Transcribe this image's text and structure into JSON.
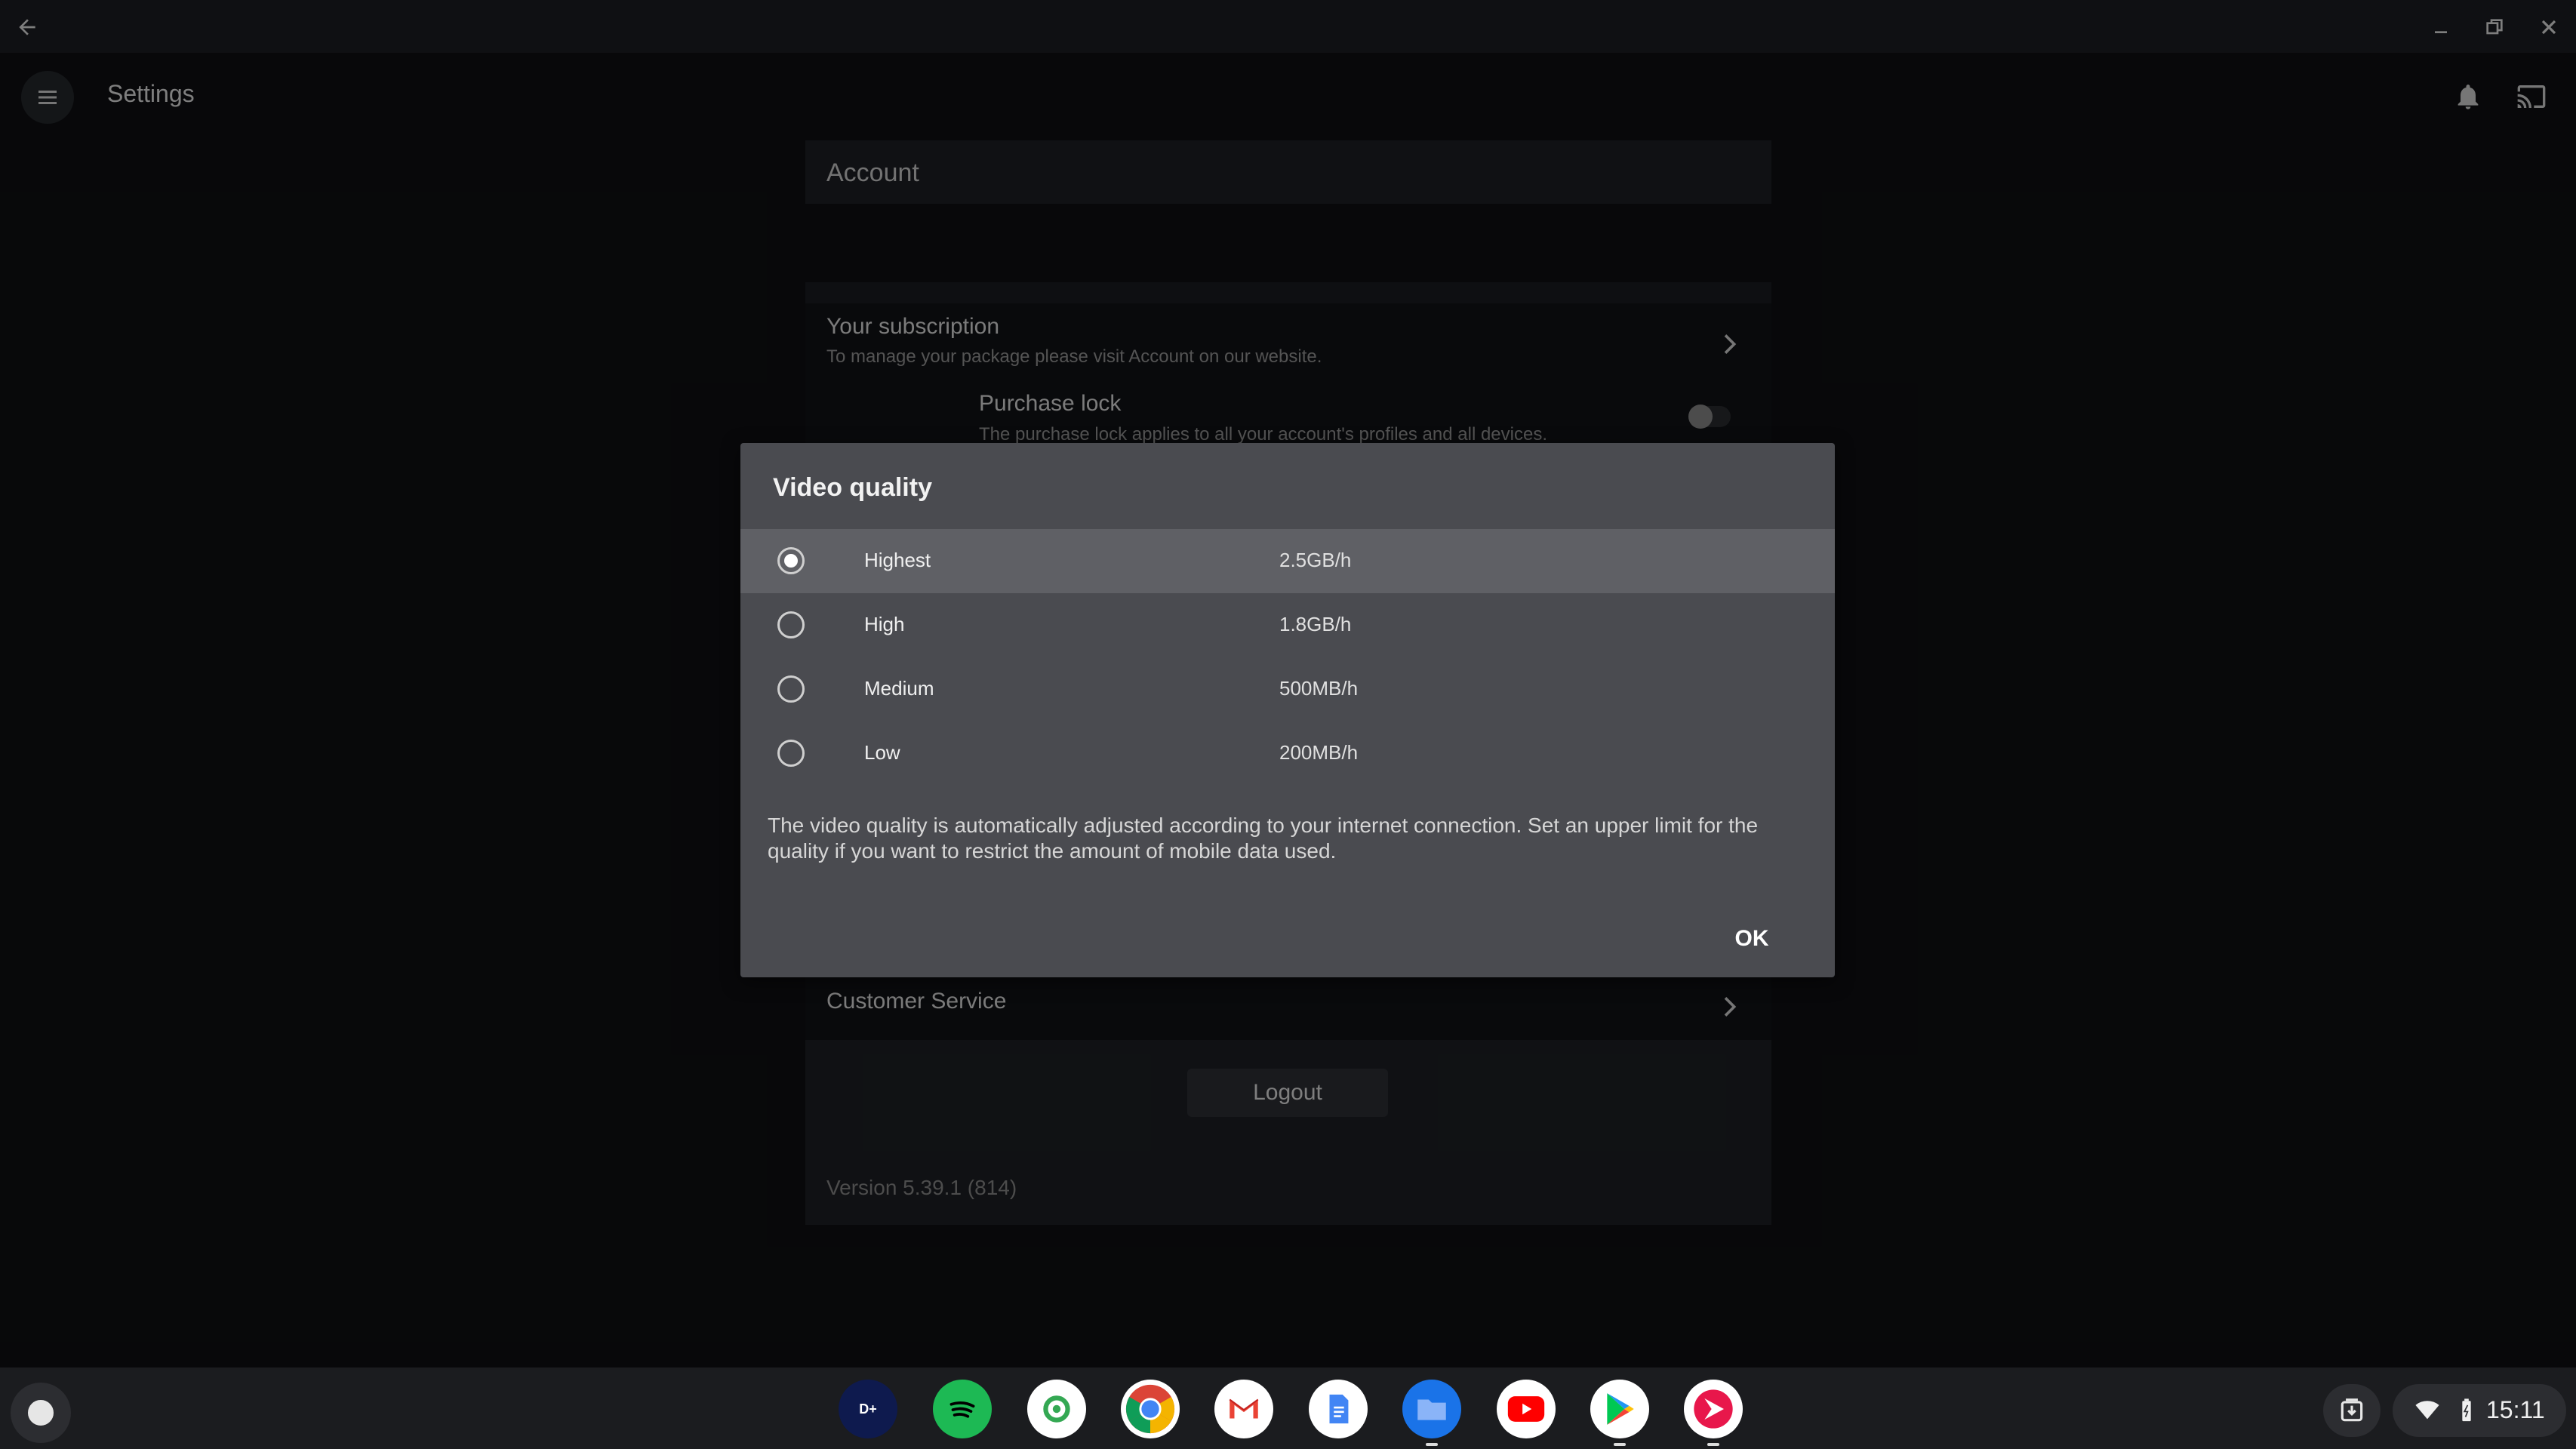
{
  "window": {
    "back_icon": "arrow-left-icon",
    "controls": [
      "minimize-icon",
      "restore-icon",
      "close-icon"
    ]
  },
  "appbar": {
    "title": "Settings",
    "menu_icon": "hamburger-menu-icon",
    "notification_icon": "bell-icon",
    "cast_icon": "cast-icon"
  },
  "settings": {
    "account_header": "Account",
    "subscription": {
      "title": "Your subscription",
      "subtitle": "To manage your package please visit Account on our website."
    },
    "purchase_lock": {
      "title": "Purchase lock",
      "subtitle": "The purchase lock applies to all your account's profiles and all devices.",
      "enabled": false
    },
    "customer_service": "Customer Service",
    "logout_label": "Logout",
    "version": "Version 5.39.1 (814)"
  },
  "dialog": {
    "title": "Video quality",
    "options": [
      {
        "label": "Highest",
        "size": "2.5GB/h",
        "selected": true
      },
      {
        "label": "High",
        "size": "1.8GB/h",
        "selected": false
      },
      {
        "label": "Medium",
        "size": "500MB/h",
        "selected": false
      },
      {
        "label": "Low",
        "size": "200MB/h",
        "selected": false
      }
    ],
    "description": "The video quality is automatically adjusted according to your internet connection. Set an upper limit for the quality if you want to restrict the amount of mobile data used.",
    "ok_label": "OK"
  },
  "shelf": {
    "apps": [
      {
        "name": "Disney+",
        "icon": "disney-plus-icon",
        "color": "#0e1a4e",
        "running": false
      },
      {
        "name": "Spotify",
        "icon": "spotify-icon",
        "color": "#1db954",
        "running": false
      },
      {
        "name": "Find My Device",
        "icon": "find-my-device-icon",
        "color": "#ffffff",
        "running": false
      },
      {
        "name": "Chrome",
        "icon": "chrome-icon",
        "color": "#4285f4",
        "running": false
      },
      {
        "name": "Gmail",
        "icon": "gmail-icon",
        "color": "#ffffff",
        "running": false
      },
      {
        "name": "Docs",
        "icon": "docs-icon",
        "color": "#ffffff",
        "running": false
      },
      {
        "name": "Files",
        "icon": "files-icon",
        "color": "#1a73e8",
        "running": true
      },
      {
        "name": "YouTube",
        "icon": "youtube-icon",
        "color": "#ffffff",
        "running": false
      },
      {
        "name": "Play Store",
        "icon": "play-store-icon",
        "color": "#ffffff",
        "running": true
      },
      {
        "name": "Viaplay",
        "icon": "viaplay-icon",
        "color": "#ffffff",
        "running": true
      }
    ],
    "clock": "15:11",
    "status_icons": [
      "wifi-icon",
      "battery-icon"
    ],
    "holding_space_icon": "holding-space-icon"
  }
}
